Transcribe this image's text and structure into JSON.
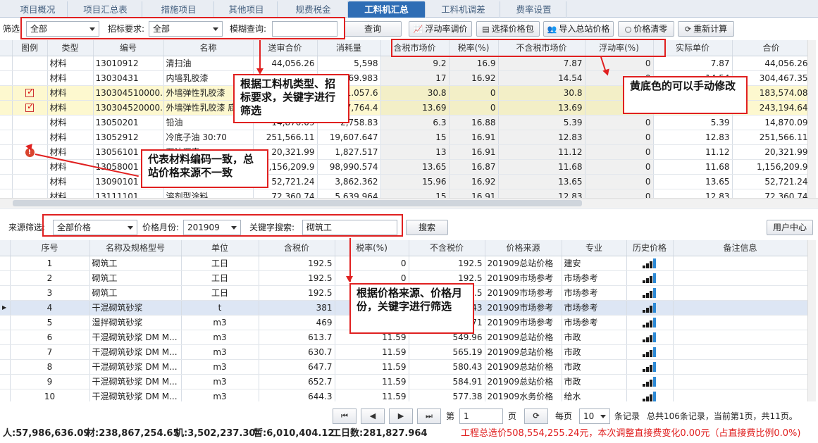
{
  "tabs": [
    "项目概况",
    "项目汇总表",
    "措施项目",
    "其他项目",
    "规费税金",
    "工料机汇总",
    "工料机调差",
    "费率设置"
  ],
  "toolbar": {
    "filter_label": "筛选:",
    "filter_value": "全部",
    "bid_req_label": "招标要求:",
    "bid_req_value": "全部",
    "fuzzy_label": "模糊查询:",
    "fuzzy_value": "",
    "query": "查询",
    "float_adjust": "浮动率调价",
    "select_price_pkg": "选择价格包",
    "import_station_price": "导入总站价格",
    "price_clear": "价格清零",
    "recalc": "重新计算"
  },
  "upper_grid": {
    "columns": [
      "图例",
      "类型",
      "编号",
      "名称",
      "送审合价",
      "消耗量",
      "含税市场价",
      "税率(%)",
      "不含税市场价",
      "浮动率(%)",
      "实际单价",
      "合价"
    ],
    "rows": [
      {
        "legend": "",
        "type": "材料",
        "code": "13010912",
        "name": "清扫油",
        "sub_total": "44,056.26",
        "qty": "5,598",
        "tax_price": "9.2",
        "rate": "16.9",
        "notax_price": "7.87",
        "float": "0",
        "actual": "7.87",
        "total": "44,056.26"
      },
      {
        "legend": "",
        "type": "材料",
        "code": "13030431",
        "name": "内墙乳胶漆",
        "sub_total": "304,467.35",
        "qty": "20,969.983",
        "tax_price": "17",
        "rate": "16.92",
        "notax_price": "14.54",
        "float": "0",
        "actual": "14.54",
        "total": "304,467.35"
      },
      {
        "legend": "check",
        "type": "材料",
        "code": "130304510000...",
        "name": "外墙弹性乳胶漆",
        "sub_total": "186,057.6",
        "qty": "6,041.057.6",
        "tax_price": "30.8",
        "rate": "0",
        "notax_price": "30.8",
        "float": "0",
        "actual": "30.8",
        "total": "183,574.08"
      },
      {
        "legend": "check",
        "type": "材料",
        "code": "130304520000...",
        "name": "外墙弹性乳胶漆 底",
        "sub_total": "243,194.64",
        "qty": "17,764.4",
        "tax_price": "13.69",
        "rate": "0",
        "notax_price": "13.69",
        "float": "0",
        "actual": "13.69",
        "total": "243,194.64"
      },
      {
        "legend": "",
        "type": "材料",
        "code": "13050201",
        "name": "铅油",
        "sub_total": "14,870.09",
        "qty": "2,758.83",
        "tax_price": "6.3",
        "rate": "16.88",
        "notax_price": "5.39",
        "float": "0",
        "actual": "5.39",
        "total": "14,870.09"
      },
      {
        "legend": "",
        "type": "材料",
        "code": "13052912",
        "name": "冷底子油 30:70",
        "sub_total": "251,566.11",
        "qty": "19,607.647",
        "tax_price": "15",
        "rate": "16.91",
        "notax_price": "12.83",
        "float": "0",
        "actual": "12.83",
        "total": "251,566.11"
      },
      {
        "legend": "warn",
        "type": "材料",
        "code": "13056101",
        "name": "石油沥青",
        "sub_total": "20,321.99",
        "qty": "1,827.517",
        "tax_price": "13",
        "rate": "16.91",
        "notax_price": "11.12",
        "float": "0",
        "actual": "11.12",
        "total": "20,321.99"
      },
      {
        "legend": "",
        "type": "材料",
        "code": "13058001",
        "name": "",
        "sub_total": "1,156,209.9",
        "qty": "98,990.574",
        "tax_price": "13.65",
        "rate": "16.87",
        "notax_price": "11.68",
        "float": "0",
        "actual": "11.68",
        "total": "1,156,209.9"
      },
      {
        "legend": "",
        "type": "材料",
        "code": "13090101",
        "name": "",
        "sub_total": "52,721.24",
        "qty": "3,862.362",
        "tax_price": "15.96",
        "rate": "16.92",
        "notax_price": "13.65",
        "float": "0",
        "actual": "13.65",
        "total": "52,721.24"
      },
      {
        "legend": "",
        "type": "材料",
        "code": "13111101",
        "name": "溶剂型涂料",
        "sub_total": "72,360.74",
        "qty": "5,639.964",
        "tax_price": "15",
        "rate": "16.91",
        "notax_price": "12.83",
        "float": "0",
        "actual": "12.83",
        "total": "72,360.74"
      }
    ]
  },
  "source_bar": {
    "source_label": "来源筛选:",
    "source_value": "全部价格",
    "month_label": "价格月份:",
    "month_value": "201909",
    "kw_label": "关键字搜索:",
    "kw_value": "砌筑工",
    "search": "搜索",
    "user_center": "用户中心"
  },
  "lower_grid": {
    "columns": [
      "序号",
      "名称及规格型号",
      "单位",
      "含税价",
      "税率(%)",
      "不含税价",
      "价格来源",
      "专业",
      "历史价格",
      "备注信息"
    ],
    "rows": [
      {
        "no": "1",
        "name": "砌筑工",
        "unit": "工日",
        "tax_price": "192.5",
        "rate": "0",
        "notax": "192.5",
        "source": "201909总站价格",
        "major": "建安"
      },
      {
        "no": "2",
        "name": "砌筑工",
        "unit": "工日",
        "tax_price": "192.5",
        "rate": "0",
        "notax": "192.5",
        "source": "201909市场参考",
        "major": "市场参考"
      },
      {
        "no": "3",
        "name": "砌筑工",
        "unit": "工日",
        "tax_price": "192.5",
        "rate": "0",
        "notax": "192.5",
        "source": "201909市场参考",
        "major": "市场参考"
      },
      {
        "no": "4",
        "name": "干混砌筑砂浆",
        "unit": "t",
        "tax_price": "381",
        "rate": "11.59",
        "notax": "341.43",
        "source": "201909市场参考",
        "major": "市场参考"
      },
      {
        "no": "5",
        "name": "湿拌砌筑砂浆",
        "unit": "m3",
        "tax_price": "469",
        "rate": "15.6",
        "notax": "405.71",
        "source": "201909市场参考",
        "major": "市场参考"
      },
      {
        "no": "6",
        "name": "干混砌筑砂浆 DM M...",
        "unit": "m3",
        "tax_price": "613.7",
        "rate": "11.59",
        "notax": "549.96",
        "source": "201909总站价格",
        "major": "市政"
      },
      {
        "no": "7",
        "name": "干混砌筑砂浆 DM M...",
        "unit": "m3",
        "tax_price": "630.7",
        "rate": "11.59",
        "notax": "565.19",
        "source": "201909总站价格",
        "major": "市政"
      },
      {
        "no": "8",
        "name": "干混砌筑砂浆 DM M...",
        "unit": "m3",
        "tax_price": "647.7",
        "rate": "11.59",
        "notax": "580.43",
        "source": "201909总站价格",
        "major": "市政"
      },
      {
        "no": "9",
        "name": "干混砌筑砂浆 DM M...",
        "unit": "m3",
        "tax_price": "652.7",
        "rate": "11.59",
        "notax": "584.91",
        "source": "201909总站价格",
        "major": "市政"
      },
      {
        "no": "10",
        "name": "干混砌筑砂浆 DM M...",
        "unit": "m3",
        "tax_price": "644.3",
        "rate": "11.59",
        "notax": "577.38",
        "source": "201909水务价格",
        "major": "给水"
      }
    ]
  },
  "pager": {
    "page_label": "第",
    "page_value": "1",
    "page_unit": "页",
    "per_page_label": "每页",
    "per_page_value": "10",
    "records_label": "条记录",
    "summary": "总共106条记录，当前第1页，共11页。"
  },
  "status": {
    "labor": "人:57,986,636.09",
    "material": "材:238,867,254.65",
    "machine": "机:3,502,237.30",
    "provisional": "暂:6,010,404.12",
    "workdays": "工日数:281,827.964",
    "total": "工程总造价508,554,255.24元，本次调整直接费变化0.00元（占直接费比例0.0%)"
  },
  "annotations": {
    "filter_note": "根据工料机类型、招标要求，关键字进行筛选",
    "yellow_note": "黄底色的可以手动修改",
    "code_note": "代表材料编码一致，总站价格来源不一致",
    "source_note": "根据价格来源、价格月份，关键字进行筛选"
  },
  "colors": {
    "accent": "#2e6db5",
    "annotation": "#e02020",
    "yellow_row": "#fdf8cf",
    "total_text": "#e02020"
  }
}
